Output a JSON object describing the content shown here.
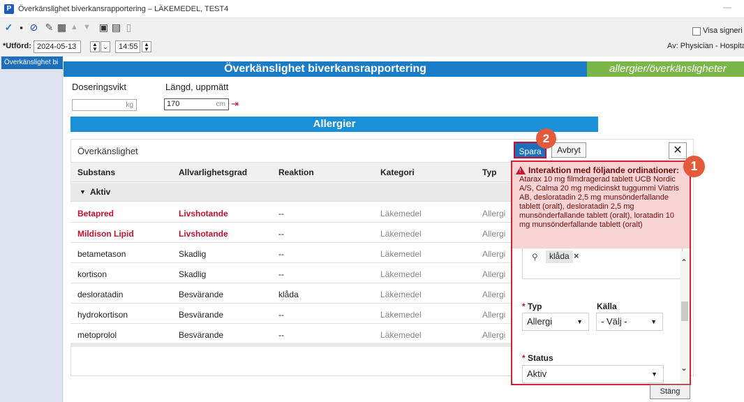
{
  "window": {
    "title": "Överkänslighet biverkansrapportering – LÄKEMEDEL, TEST4",
    "app_icon": "P",
    "minimize": "—"
  },
  "toolbar": {
    "visa_signering": "Visa signeri"
  },
  "utford": {
    "label": "*Utförd:",
    "date": "2024-05-13",
    "time": "14:55"
  },
  "av": {
    "label": "Av:  Physician - Hospitalis"
  },
  "nav": {
    "item": "Överkänslighet bi"
  },
  "form": {
    "header": "Överkänslighet biverkansrapportering",
    "header_right": "allergier/överkänsligheter",
    "dose_label": "Doseringsvikt",
    "dose_unit": "kg",
    "length_label": "Längd, uppmätt",
    "length_value": "170",
    "length_unit": "cm",
    "allergier": "Allergier"
  },
  "table": {
    "section_label": "Överkänslighet",
    "columns": [
      "Substans",
      "Allvarlighetsgrad",
      "Reaktion",
      "Kategori",
      "Typ"
    ],
    "group": "Aktiv",
    "rows": [
      {
        "substans": "Betapred",
        "grad": "Livshotande",
        "reaktion": "--",
        "kategori": "Läkemedel",
        "typ": "Allergi",
        "severe": true
      },
      {
        "substans": "Mildison Lipid",
        "grad": "Livshotande",
        "reaktion": "--",
        "kategori": "Läkemedel",
        "typ": "Allergi",
        "severe": true
      },
      {
        "substans": "betametason",
        "grad": "Skadlig",
        "reaktion": "--",
        "kategori": "Läkemedel",
        "typ": "Allergi",
        "severe": false
      },
      {
        "substans": "kortison",
        "grad": "Skadlig",
        "reaktion": "--",
        "kategori": "Läkemedel",
        "typ": "Allergi",
        "severe": false
      },
      {
        "substans": "desloratadin",
        "grad": "Besvärande",
        "reaktion": "klåda",
        "kategori": "Läkemedel",
        "typ": "Allergi",
        "severe": false
      },
      {
        "substans": "hydrokortison",
        "grad": "Besvärande",
        "reaktion": "--",
        "kategori": "Läkemedel",
        "typ": "Allergi",
        "severe": false
      },
      {
        "substans": "metoprolol",
        "grad": "Besvärande",
        "reaktion": "--",
        "kategori": "Läkemedel",
        "typ": "Allergi",
        "severe": false
      }
    ]
  },
  "buttons": {
    "spara": "Spara",
    "avbryt": "Avbryt",
    "close": "✕",
    "stang": "Stäng"
  },
  "markers": {
    "one": "1",
    "two": "2"
  },
  "warning": {
    "title": "Interaktion med följande ordinationer:",
    "text": "Atarax 10 mg filmdragerad tablett UCB Nordic A/S, Calma 20 mg medicinskt tuggummi Viatris AB, desloratadin 2,5 mg munsönderfallande tablett (oralt), desloratadin 2,5 mg munsönderfallande tablett (oralt), loratadin 10 mg munsönderfallande tablett (oralt)"
  },
  "panel": {
    "reaction_tag": "klåda",
    "typ_label": "Typ",
    "typ_value": "Allergi",
    "kalla_label": "Källa",
    "kalla_value": "- Välj -",
    "status_label": "Status",
    "status_value": "Aktiv"
  },
  "colors": {
    "primary": "#1a7bc6",
    "green": "#7ab648",
    "danger": "#c8102e",
    "warning_bg": "#f8d3d3",
    "marker": "#e45a3a"
  }
}
